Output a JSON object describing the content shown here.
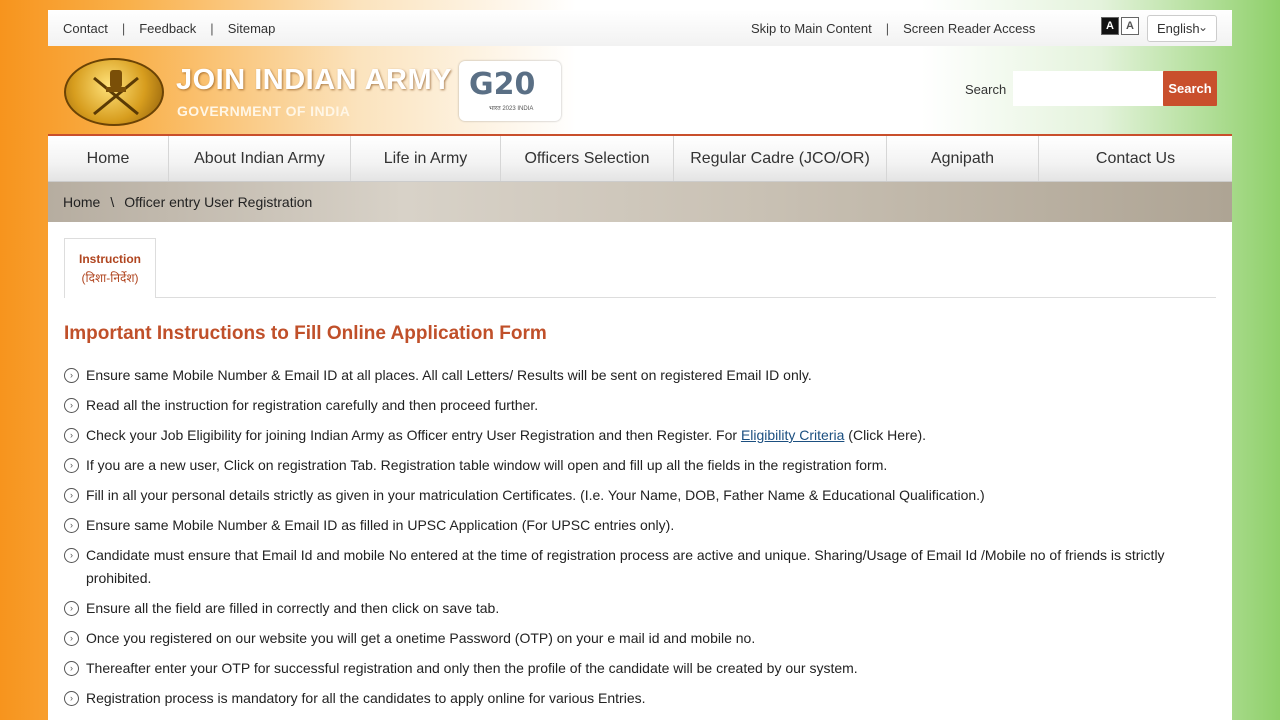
{
  "utility": {
    "contact": "Contact",
    "feedback": "Feedback",
    "sitemap": "Sitemap",
    "skip": "Skip to Main Content",
    "screen_reader": "Screen Reader Access",
    "font_dark": "A",
    "font_light": "A",
    "language": "English"
  },
  "header": {
    "title": "JOIN INDIAN ARMY",
    "subtitle": "GOVERNMENT OF INDIA",
    "g20_text": "G20",
    "g20_caption": "भारत 2023 INDIA",
    "search_label": "Search",
    "search_button": "Search"
  },
  "nav": [
    {
      "label": "Home"
    },
    {
      "label": "About Indian Army"
    },
    {
      "label": "Life in Army"
    },
    {
      "label": "Officers Selection"
    },
    {
      "label": "Regular Cadre (JCO/OR)"
    },
    {
      "label": "Agnipath"
    },
    {
      "label": "Contact Us"
    }
  ],
  "breadcrumb": {
    "home": "Home",
    "separator": "\\",
    "current": "Officer entry User Registration"
  },
  "tab": {
    "label": "Instruction",
    "sub": "(दिशा-निर्देश)"
  },
  "heading": "Important Instructions to Fill Online Application Form",
  "instructions": [
    {
      "text": "Ensure same Mobile Number & Email ID at all places. All call Letters/ Results will be sent on registered Email ID only."
    },
    {
      "text": "Read all the instruction for registration carefully and then proceed further."
    },
    {
      "text_before": "Check your Job Eligibility for joining Indian Army as Officer entry User Registration and then Register. For ",
      "link": "Eligibility Criteria",
      "text_after": " (Click Here)."
    },
    {
      "text": "If you are a new user, Click on registration Tab. Registration table window will open and fill up all the fields in the registration form."
    },
    {
      "text": "Fill in all your personal details strictly as given in your matriculation Certificates. (I.e. Your Name, DOB, Father Name & Educational Qualification.)"
    },
    {
      "text": "Ensure same Mobile Number & Email ID as filled in UPSC Application (For UPSC entries only)."
    },
    {
      "text": "Candidate must ensure that Email Id and mobile No entered at the time of registration process are active and unique. Sharing/Usage of Email Id /Mobile no of friends is strictly prohibited."
    },
    {
      "text": "Ensure all the field are filled in correctly and then click on save tab."
    },
    {
      "text": "Once you registered on our website you will get a onetime Password (OTP) on your e mail id and mobile no."
    },
    {
      "text": "Thereafter enter your OTP for successful registration and only then the profile of the candidate will be created by our system."
    },
    {
      "text": "Registration process is mandatory for all the candidates to apply online for various Entries."
    }
  ]
}
